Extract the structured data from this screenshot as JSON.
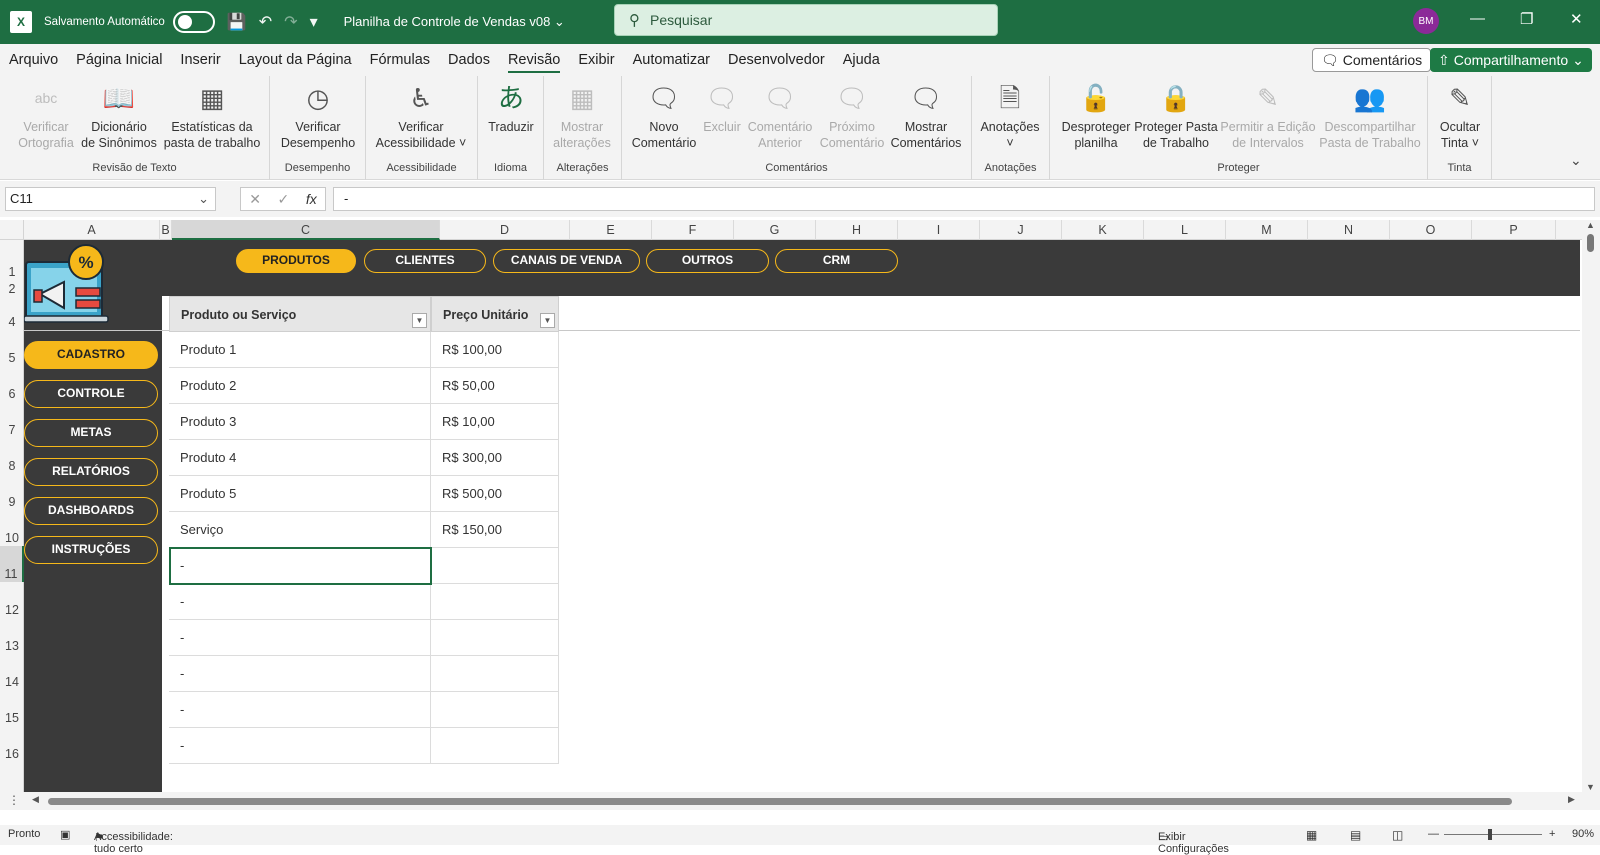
{
  "window": {
    "autosave_label": "Salvamento Automático",
    "doc_title": "Planilha de Controle de Vendas v08",
    "search_placeholder": "Pesquisar",
    "avatar": "BM"
  },
  "menu": [
    "Arquivo",
    "Página Inicial",
    "Inserir",
    "Layout da Página",
    "Fórmulas",
    "Dados",
    "Revisão",
    "Exibir",
    "Automatizar",
    "Desenvolvedor",
    "Ajuda"
  ],
  "menu_active": "Revisão",
  "header_buttons": {
    "comments": "Comentários",
    "share": "Compartilhamento"
  },
  "ribbon": {
    "groups": [
      {
        "label": "Revisão de Texto",
        "buttons": [
          {
            "l1": "Verificar",
            "l2": "Ortografia",
            "icon": "spellcheck-icon",
            "disabled": true
          },
          {
            "l1": "Dicionário",
            "l2": "de Sinônimos",
            "icon": "thesaurus-icon",
            "disabled": false
          },
          {
            "l1": "Estatísticas da",
            "l2": "pasta de trabalho",
            "icon": "workbook-stats-icon",
            "disabled": false
          }
        ]
      },
      {
        "label": "Desempenho",
        "buttons": [
          {
            "l1": "Verificar",
            "l2": "Desempenho",
            "icon": "performance-icon",
            "disabled": false
          }
        ]
      },
      {
        "label": "Acessibilidade",
        "buttons": [
          {
            "l1": "Verificar",
            "l2": "Acessibilidade ˅",
            "icon": "accessibility-icon",
            "disabled": false
          }
        ]
      },
      {
        "label": "Idioma",
        "buttons": [
          {
            "l1": "Traduzir",
            "l2": "",
            "icon": "translate-icon",
            "disabled": false
          }
        ]
      },
      {
        "label": "Alterações",
        "buttons": [
          {
            "l1": "Mostrar",
            "l2": "alterações",
            "icon": "show-changes-icon",
            "disabled": true
          }
        ]
      },
      {
        "label": "Comentários",
        "buttons": [
          {
            "l1": "Novo",
            "l2": "Comentário",
            "icon": "new-comment-icon",
            "disabled": false
          },
          {
            "l1": "Excluir",
            "l2": "",
            "icon": "delete-comment-icon",
            "disabled": true
          },
          {
            "l1": "Comentário",
            "l2": "Anterior",
            "icon": "previous-comment-icon",
            "disabled": true
          },
          {
            "l1": "Próximo",
            "l2": "Comentário",
            "icon": "next-comment-icon",
            "disabled": true
          },
          {
            "l1": "Mostrar",
            "l2": "Comentários",
            "icon": "show-comments-icon",
            "disabled": false
          }
        ]
      },
      {
        "label": "Anotações",
        "buttons": [
          {
            "l1": "Anotações",
            "l2": "˅",
            "icon": "notes-icon",
            "disabled": false
          }
        ]
      },
      {
        "label": "Proteger",
        "buttons": [
          {
            "l1": "Desproteger",
            "l2": "planilha",
            "icon": "unprotect-sheet-icon",
            "disabled": false
          },
          {
            "l1": "Proteger Pasta",
            "l2": "de Trabalho",
            "icon": "protect-workbook-icon",
            "disabled": false
          },
          {
            "l1": "Permitir a Edição",
            "l2": "de Intervalos",
            "icon": "allow-edit-ranges-icon",
            "disabled": true
          },
          {
            "l1": "Descompartilhar",
            "l2": "Pasta de Trabalho",
            "icon": "unshare-workbook-icon",
            "disabled": true
          }
        ]
      },
      {
        "label": "Tinta",
        "buttons": [
          {
            "l1": "Ocultar",
            "l2": "Tinta ˅",
            "icon": "hide-ink-icon",
            "disabled": false
          }
        ]
      }
    ]
  },
  "formula_bar": {
    "name_box": "C11",
    "formula": "-"
  },
  "columns": [
    "A",
    "B",
    "C",
    "D",
    "E",
    "F",
    "G",
    "H",
    "I",
    "J",
    "K",
    "L",
    "M",
    "N",
    "O",
    "P"
  ],
  "selected_column": "C",
  "rows": [
    "1",
    "2",
    "4",
    "5",
    "6",
    "7",
    "8",
    "9",
    "10",
    "11",
    "12",
    "13",
    "14",
    "15",
    "16"
  ],
  "selected_row": "11",
  "top_nav": [
    {
      "label": "PRODUTOS",
      "active": true
    },
    {
      "label": "CLIENTES",
      "active": false
    },
    {
      "label": "CANAIS DE VENDA",
      "active": false
    },
    {
      "label": "OUTROS",
      "active": false
    },
    {
      "label": "CRM",
      "active": false
    }
  ],
  "side_nav": [
    {
      "label": "CADASTRO",
      "active": true
    },
    {
      "label": "CONTROLE",
      "active": false
    },
    {
      "label": "METAS",
      "active": false
    },
    {
      "label": "RELATÓRIOS",
      "active": false
    },
    {
      "label": "DASHBOARDS",
      "active": false
    },
    {
      "label": "INSTRUÇÕES",
      "active": false
    }
  ],
  "table": {
    "headers": [
      "Produto ou Serviço",
      "Preço Unitário"
    ],
    "rows": [
      [
        "Produto 1",
        "R$ 100,00"
      ],
      [
        "Produto 2",
        "R$ 50,00"
      ],
      [
        "Produto 3",
        "R$ 10,00"
      ],
      [
        "Produto 4",
        "R$ 300,00"
      ],
      [
        "Produto 5",
        "R$ 500,00"
      ],
      [
        "Serviço",
        "R$ 150,00"
      ],
      [
        "-",
        ""
      ],
      [
        "-",
        ""
      ],
      [
        "-",
        ""
      ],
      [
        "-",
        ""
      ],
      [
        "-",
        ""
      ],
      [
        "-",
        ""
      ]
    ]
  },
  "status": {
    "ready": "Pronto",
    "accessibility": "Accessibilidade: tudo certo",
    "display_settings": "Exibir Configurações",
    "zoom": "90%"
  },
  "colors": {
    "ribbon_green": "#1e6e42",
    "accent_yellow": "#f6b81a",
    "dark_panel": "#3a3a3a"
  }
}
